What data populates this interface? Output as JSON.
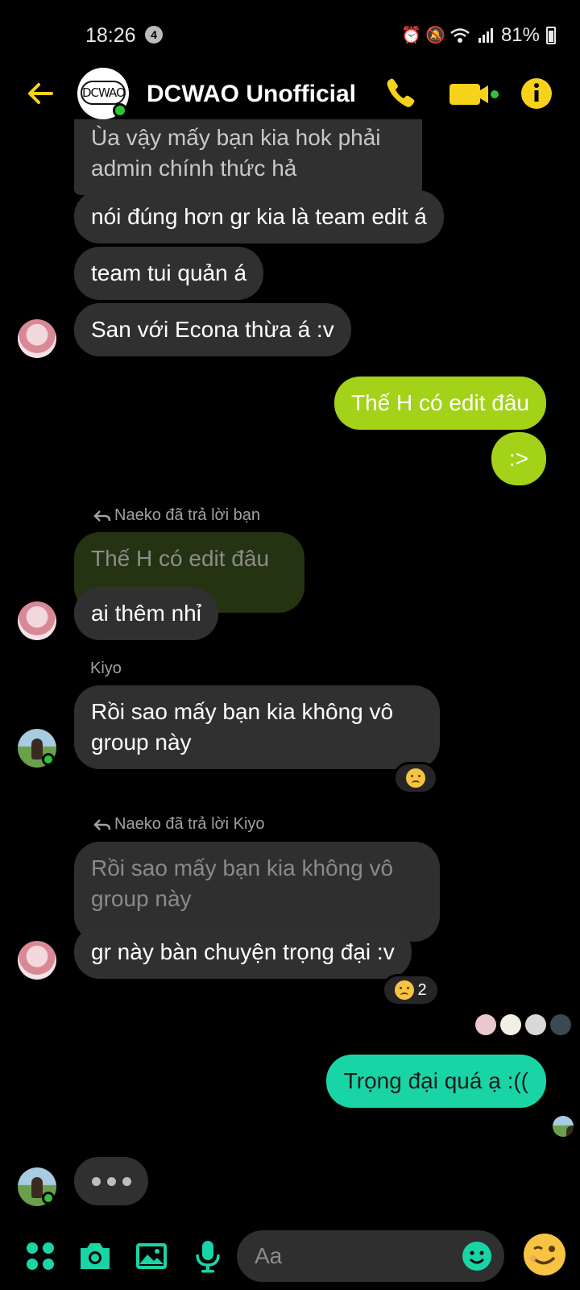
{
  "status_bar": {
    "time": "18:26",
    "notification_count": "4",
    "battery": "81%"
  },
  "header": {
    "title": "DCWAO Unofficial",
    "avatar_text": "DCWAO"
  },
  "colors": {
    "accent": "#f6d21a",
    "outgoing_lime": "#a3d219",
    "outgoing_teal": "#19d5a6",
    "incoming": "#303030",
    "online": "#31c23b"
  },
  "messages": {
    "m1": "Ùa vậy mấy bạn kia hok phải\nadmin chính thức hả",
    "m2": "nói đúng hơn gr kia là team edit á",
    "m3": "team tui quản á",
    "m4": "San với Econa thừa á :v",
    "m5": "Thế H có edit đâu",
    "m6": ":>",
    "reply1_label": "Naeko đã trả lời bạn",
    "reply1_quote": "Thế H có edit đâu",
    "m7": "ai thêm nhỉ",
    "kiyo_name": "Kiyo",
    "m8": "Rồi sao mấy bạn kia không vô\ngroup này",
    "reply2_label": "Naeko đã trả lời Kiyo",
    "reply2_quote": "Rồi sao mấy bạn kia không vô\ngroup này",
    "m9": "gr này bàn chuyện trọng đại :v",
    "reaction2_count": "2",
    "m10": "Trọng đại quá ạ :(("
  },
  "composer": {
    "placeholder": "Aa"
  },
  "icons": [
    "back-arrow-icon",
    "phone-icon",
    "video-camera-icon",
    "info-icon",
    "apps-grid-icon",
    "camera-icon",
    "gallery-icon",
    "microphone-icon",
    "emoji-icon",
    "wink-emoji-icon",
    "reply-arrow-icon"
  ]
}
